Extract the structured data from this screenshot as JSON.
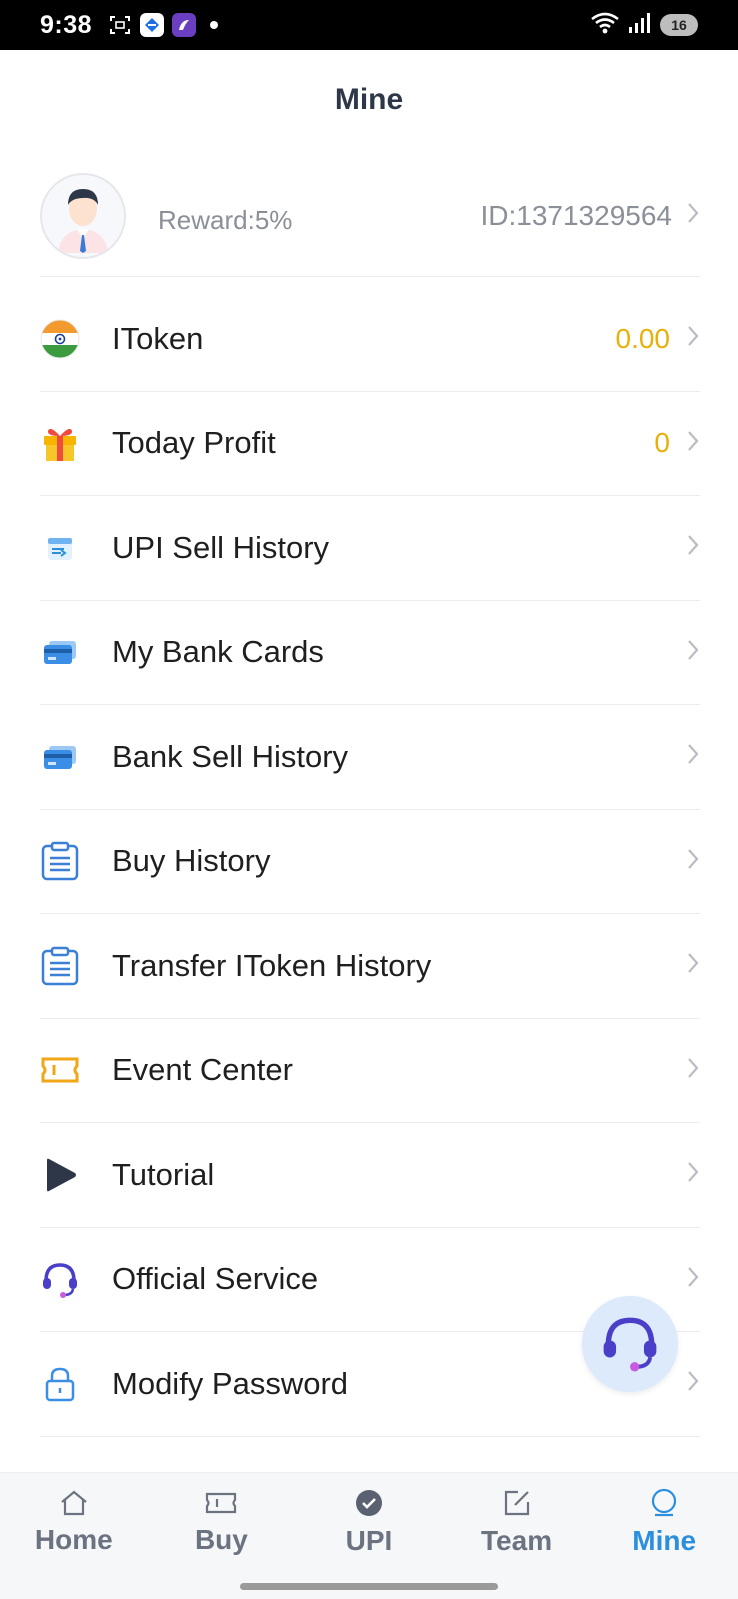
{
  "status_bar": {
    "time": "9:38",
    "battery": "16"
  },
  "header": {
    "title": "Mine"
  },
  "profile": {
    "reward": "Reward:5%",
    "id": "ID:1371329564"
  },
  "menu": {
    "items": [
      {
        "label": "IToken",
        "value": "0.00",
        "icon": "india-flag-icon"
      },
      {
        "label": "Today Profit",
        "value": "0",
        "icon": "gift-icon"
      },
      {
        "label": "UPI Sell History",
        "icon": "upi-transfer-icon"
      },
      {
        "label": "My Bank Cards",
        "icon": "bank-card-icon"
      },
      {
        "label": "Bank Sell History",
        "icon": "bank-card-icon"
      },
      {
        "label": "Buy History",
        "icon": "clipboard-icon"
      },
      {
        "label": "Transfer IToken History",
        "icon": "clipboard-icon"
      },
      {
        "label": "Event Center",
        "icon": "ticket-icon"
      },
      {
        "label": "Tutorial",
        "icon": "play-icon"
      },
      {
        "label": "Official Service",
        "icon": "headset-icon"
      },
      {
        "label": "Modify Password",
        "icon": "lock-icon"
      }
    ]
  },
  "tabs": [
    {
      "label": "Home",
      "icon": "home-icon"
    },
    {
      "label": "Buy",
      "icon": "ticket-icon"
    },
    {
      "label": "UPI",
      "icon": "check-circle-icon"
    },
    {
      "label": "Team",
      "icon": "edit-square-icon"
    },
    {
      "label": "Mine",
      "icon": "user-circle-icon",
      "active": true
    }
  ],
  "colors": {
    "accent": "#2b8fde",
    "value": "#e8b10a",
    "title": "#2d3747"
  }
}
